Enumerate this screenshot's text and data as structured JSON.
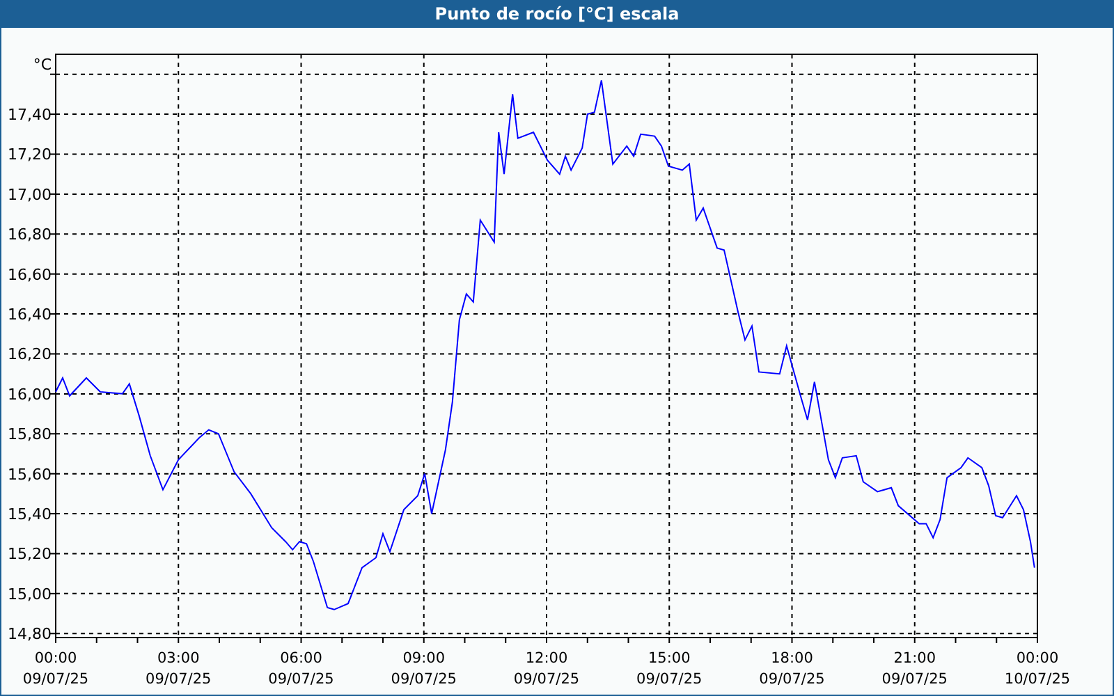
{
  "window": {
    "title": "Punto de rocío [°C] escala"
  },
  "chart": {
    "chart_data": {
      "type": "line",
      "ylabel": "°C",
      "xlim": [
        0,
        24
      ],
      "ylim": [
        14.78,
        17.7
      ],
      "x": [
        0,
        0.17,
        0.34,
        0.75,
        1.09,
        1.63,
        1.8,
        2.04,
        2.31,
        2.62,
        3,
        3.51,
        3.74,
        3.98,
        4.36,
        4.77,
        5.28,
        5.62,
        5.79,
        5.96,
        6.13,
        6.3,
        6.64,
        6.81,
        7.15,
        7.49,
        7.83,
        8,
        8.17,
        8.51,
        8.85,
        9.02,
        9.19,
        9.53,
        9.7,
        9.87,
        10.04,
        10.21,
        10.38,
        10.72,
        10.83,
        10.96,
        11.17,
        11.3,
        11.68,
        12.02,
        12.32,
        12.46,
        12.6,
        12.87,
        13,
        13.17,
        13.34,
        13.62,
        13.96,
        14.13,
        14.3,
        14.64,
        14.81,
        14.98,
        15.32,
        15.49,
        15.66,
        15.83,
        16.17,
        16.34,
        16.68,
        16.85,
        17.02,
        17.19,
        17.7,
        17.87,
        18.21,
        18.38,
        18.55,
        18.89,
        19.06,
        19.23,
        19.57,
        19.74,
        20.09,
        20.43,
        20.6,
        21.11,
        21.28,
        21.45,
        21.62,
        21.79,
        22.13,
        22.3,
        22.64,
        22.81,
        22.98,
        23.15,
        23.49,
        23.66,
        23.83,
        23.93
      ],
      "series": [
        {
          "color": "#0000ff",
          "values": [
            16.01,
            16.08,
            15.99,
            16.08,
            16.01,
            16,
            16.05,
            15.89,
            15.69,
            15.52,
            15.67,
            15.78,
            15.82,
            15.8,
            15.61,
            15.5,
            15.33,
            15.26,
            15.22,
            15.26,
            15.25,
            15.16,
            14.93,
            14.92,
            14.95,
            15.13,
            15.18,
            15.3,
            15.21,
            15.42,
            15.49,
            15.6,
            15.4,
            15.72,
            15.96,
            16.37,
            16.5,
            16.46,
            16.87,
            16.76,
            17.31,
            17.1,
            17.5,
            17.28,
            17.31,
            17.17,
            17.1,
            17.19,
            17.12,
            17.23,
            17.4,
            17.41,
            17.57,
            17.15,
            17.24,
            17.19,
            17.3,
            17.29,
            17.24,
            17.14,
            17.12,
            17.15,
            16.87,
            16.93,
            16.73,
            16.72,
            16.41,
            16.27,
            16.34,
            16.11,
            16.1,
            16.24,
            15.99,
            15.87,
            16.06,
            15.67,
            15.58,
            15.68,
            15.69,
            15.56,
            15.51,
            15.53,
            15.44,
            15.35,
            15.35,
            15.28,
            15.37,
            15.58,
            15.63,
            15.68,
            15.63,
            15.54,
            15.39,
            15.38,
            15.49,
            15.42,
            15.26,
            15.13
          ]
        }
      ],
      "yticks": [
        {
          "value": 14.8,
          "label": "14,80"
        },
        {
          "value": 15,
          "label": "15,00"
        },
        {
          "value": 15.2,
          "label": "15,20"
        },
        {
          "value": 15.4,
          "label": "15,40"
        },
        {
          "value": 15.6,
          "label": "15,60"
        },
        {
          "value": 15.8,
          "label": "15,80"
        },
        {
          "value": 16,
          "label": "16,00"
        },
        {
          "value": 16.2,
          "label": "16,20"
        },
        {
          "value": 16.4,
          "label": "16,40"
        },
        {
          "value": 16.6,
          "label": "16,60"
        },
        {
          "value": 16.8,
          "label": "16,80"
        },
        {
          "value": 17,
          "label": "17,00"
        },
        {
          "value": 17.2,
          "label": "17,20"
        },
        {
          "value": 17.4,
          "label": "17,40"
        }
      ],
      "grid": true,
      "xticks": [
        {
          "value": 0,
          "label": "00:00"
        },
        {
          "value": 3,
          "label": "03:00"
        },
        {
          "value": 6,
          "label": "06:00"
        },
        {
          "value": 9,
          "label": "09:00"
        },
        {
          "value": 12,
          "label": "12:00"
        },
        {
          "value": 15,
          "label": "15:00"
        },
        {
          "value": 18,
          "label": "18:00"
        },
        {
          "value": 21,
          "label": "21:00"
        },
        {
          "value": 24,
          "label": "00:00"
        }
      ]
    },
    "tick_dates": [
      "09/07/25",
      "09/07/25",
      "09/07/25",
      "09/07/25",
      "09/07/25",
      "09/07/25",
      "09/07/25",
      "09/07/25",
      "10/07/25"
    ]
  }
}
